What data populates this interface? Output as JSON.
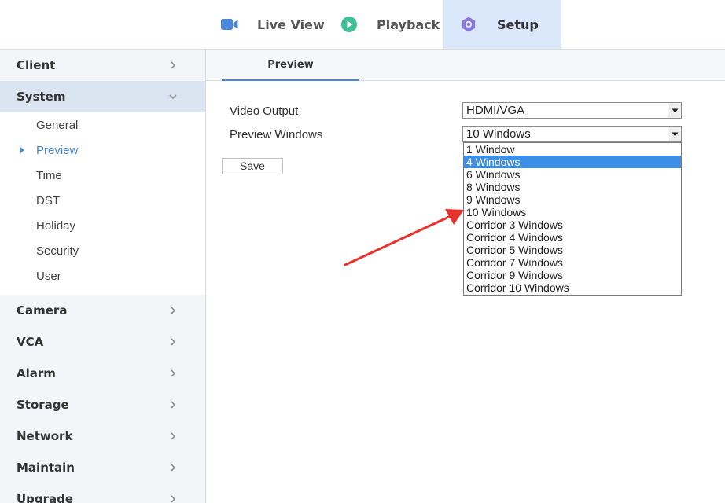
{
  "topnav": {
    "items": [
      {
        "label": "Live View",
        "icon": "video-camera-icon"
      },
      {
        "label": "Playback",
        "icon": "play-circle-icon"
      },
      {
        "label": "Setup",
        "icon": "gear-icon"
      }
    ],
    "active": "Setup",
    "accent": "#4a87d8",
    "active_bg": "#dbe8fb"
  },
  "sidebar": {
    "groups": [
      {
        "label": "Client"
      },
      {
        "label": "System",
        "expanded": true,
        "items": [
          {
            "label": "General"
          },
          {
            "label": "Preview",
            "active": true
          },
          {
            "label": "Time"
          },
          {
            "label": "DST"
          },
          {
            "label": "Holiday"
          },
          {
            "label": "Security"
          },
          {
            "label": "User"
          }
        ]
      },
      {
        "label": "Camera"
      },
      {
        "label": "VCA"
      },
      {
        "label": "Alarm"
      },
      {
        "label": "Storage"
      },
      {
        "label": "Network"
      },
      {
        "label": "Maintain"
      },
      {
        "label": "Upgrade"
      }
    ]
  },
  "main": {
    "tab": "Preview",
    "fields": {
      "video_output": {
        "label": "Video Output",
        "value": "HDMI/VGA"
      },
      "preview_windows": {
        "label": "Preview Windows",
        "value": "10 Windows"
      }
    },
    "save_label": "Save",
    "dropdown": {
      "options": [
        "1 Window",
        "4 Windows",
        "6 Windows",
        "8 Windows",
        "9 Windows",
        "10 Windows",
        "Corridor 3 Windows",
        "Corridor 4 Windows",
        "Corridor 5 Windows",
        "Corridor 7 Windows",
        "Corridor 9 Windows",
        "Corridor 10 Windows"
      ],
      "highlighted": "4 Windows",
      "highlight_color": "#3d8fe6"
    },
    "annotation_arrow_color": "#e8322b"
  }
}
